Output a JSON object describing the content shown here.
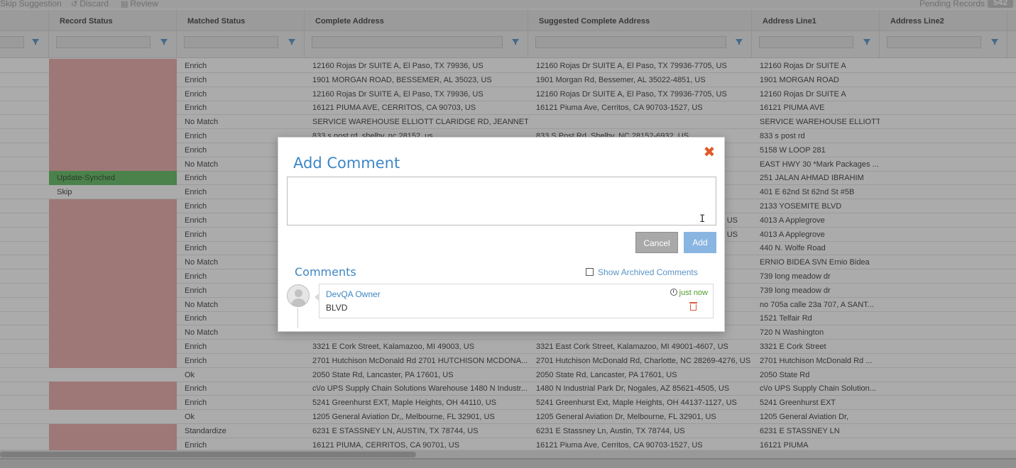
{
  "toolbar": {
    "skip_suggestion": "Skip Suggestion",
    "discard": "Discard",
    "review": "Review",
    "pending_records_label": "Pending Records",
    "pending_count": "542"
  },
  "grid": {
    "columns": [
      "Record Status",
      "Matched Status",
      "Complete Address",
      "Suggested Complete Address",
      "Address Line1",
      "Address Line2"
    ],
    "rows": [
      {
        "status": "",
        "status_color": "red",
        "matched": "Enrich",
        "complete": "12160 Rojas Dr SUITE A, El Paso, TX 79936, US",
        "suggested": "12160 Rojas Dr SUITE A, El Paso, TX 79936-7705, US",
        "line1": "12160 Rojas Dr SUITE A",
        "line2": ""
      },
      {
        "status": "",
        "status_color": "red",
        "matched": "Enrich",
        "complete": "1901 MORGAN ROAD, BESSEMER, AL 35023, US",
        "suggested": "1901 Morgan Rd, Bessemer, AL 35022-4851, US",
        "line1": "1901 MORGAN ROAD",
        "line2": ""
      },
      {
        "status": "",
        "status_color": "red",
        "matched": "Enrich",
        "complete": "12160 Rojas Dr SUITE A, El Paso, TX 79936, US",
        "suggested": "12160 Rojas Dr SUITE A, El Paso, TX 79936-7705, US",
        "line1": "12160 Rojas Dr SUITE A",
        "line2": ""
      },
      {
        "status": "",
        "status_color": "red",
        "matched": "Enrich",
        "complete": "16121 PIUMA AVE, CERRITOS, CA 90703, US",
        "suggested": "16121 Piuma Ave, Cerritos, CA 90703-1527, US",
        "line1": "16121 PIUMA AVE",
        "line2": ""
      },
      {
        "status": "",
        "status_color": "red",
        "matched": "No Match",
        "complete": "SERVICE WAREHOUSE ELLIOTT CLARIDGE RD, JEANNETTE, ...",
        "suggested": "",
        "line1": "SERVICE WAREHOUSE ELLIOTT ...",
        "line2": ""
      },
      {
        "status": "",
        "status_color": "red",
        "matched": "Enrich",
        "complete": "833 s post rd, shelby, nc 28152, us",
        "suggested": "833 S Post Rd, Shelby, NC 28152-6932, US",
        "line1": "833 s post rd",
        "line2": ""
      },
      {
        "status": "",
        "status_color": "red",
        "matched": "Enrich",
        "complete": "",
        "suggested": "",
        "line1": "5158 W LOOP 281",
        "line2": ""
      },
      {
        "status": "",
        "status_color": "red",
        "matched": "No Match",
        "complete": "",
        "suggested": "",
        "line1": "EAST HWY 30 *Mark Packages ...",
        "line2": ""
      },
      {
        "status": "Update-Synched",
        "status_color": "green",
        "matched": "Enrich",
        "complete": "",
        "suggested": "",
        "line1": "251 JALAN AHMAD IBRAHIM",
        "line2": ""
      },
      {
        "status": "Skip",
        "status_color": "none",
        "matched": "Enrich",
        "complete": "",
        "suggested": "",
        "line1": "401 E 62nd St 62nd St #5B",
        "line2": ""
      },
      {
        "status": "",
        "status_color": "red",
        "matched": "Enrich",
        "complete": "",
        "suggested": "",
        "line1": "2133 YOSEMITE BLVD",
        "line2": ""
      },
      {
        "status": "",
        "status_color": "red",
        "matched": "Enrich",
        "complete": "",
        "suggested": ", US",
        "line1": "4013 A Applegrove",
        "line2": ""
      },
      {
        "status": "",
        "status_color": "red",
        "matched": "Enrich",
        "complete": "",
        "suggested": ", US",
        "line1": "4013 A Applegrove",
        "line2": ""
      },
      {
        "status": "",
        "status_color": "red",
        "matched": "Enrich",
        "complete": "",
        "suggested": "",
        "line1": "440 N. Wolfe Road",
        "line2": ""
      },
      {
        "status": "",
        "status_color": "red",
        "matched": "No Match",
        "complete": "",
        "suggested": "",
        "line1": "ERNIO BIDEA S\\/N Ernio Bidea",
        "line2": ""
      },
      {
        "status": "",
        "status_color": "red",
        "matched": "Enrich",
        "complete": "",
        "suggested": "",
        "line1": "739 long meadow dr",
        "line2": ""
      },
      {
        "status": "",
        "status_color": "red",
        "matched": "Enrich",
        "complete": "",
        "suggested": "",
        "line1": "739 long meadow dr",
        "line2": ""
      },
      {
        "status": "",
        "status_color": "red",
        "matched": "No Match",
        "complete": "",
        "suggested": "",
        "line1": "no 705a calle 23a 707, A SANT...",
        "line2": ""
      },
      {
        "status": "",
        "status_color": "red",
        "matched": "Enrich",
        "complete": "",
        "suggested": "",
        "line1": "1521 Telfair Rd",
        "line2": ""
      },
      {
        "status": "",
        "status_color": "red",
        "matched": "No Match",
        "complete": "",
        "suggested": "",
        "line1": "720 N Washington",
        "line2": ""
      },
      {
        "status": "",
        "status_color": "red",
        "matched": "Enrich",
        "complete": "3321 E Cork Street, Kalamazoo, MI 49003, US",
        "suggested": "3321 East Cork Street, Kalamazoo, MI 49001-4607, US",
        "line1": "3321 E Cork Street",
        "line2": ""
      },
      {
        "status": "",
        "status_color": "red",
        "matched": "Enrich",
        "complete": "2701 Hutchison McDonald Rd 2701 HUTCHISON MCDONA...",
        "suggested": "2701 Hutchison McDonald Rd, Charlotte, NC 28269-4276, US",
        "line1": "2701 Hutchison McDonald Rd ...",
        "line2": ""
      },
      {
        "status": "",
        "status_color": "none",
        "matched": "Ok",
        "complete": "2050 State Rd, Lancaster, PA 17601, US",
        "suggested": "2050 State Rd, Lancaster, PA 17601, US",
        "line1": "2050 State Rd",
        "line2": ""
      },
      {
        "status": "",
        "status_color": "red",
        "matched": "Enrich",
        "complete": "c\\/o UPS Supply Chain Solutions Warehouse 1480 N Industr...",
        "suggested": "1480 N Industrial Park Dr, Nogales, AZ 85621-4505, US",
        "line1": "c\\/o UPS Supply Chain Solution...",
        "line2": ""
      },
      {
        "status": "",
        "status_color": "red",
        "matched": "Enrich",
        "complete": "5241 Greenhurst EXT, Maple Heights, OH 44110, US",
        "suggested": "5241 Greenhurst Ext, Maple Heights, OH 44137-1127, US",
        "line1": "5241 Greenhurst EXT",
        "line2": ""
      },
      {
        "status": "",
        "status_color": "none",
        "matched": "Ok",
        "complete": "1205 General Aviation Dr,, Melbourne, FL 32901, US",
        "suggested": "1205 General Aviation Dr, Melbourne, FL 32901, US",
        "line1": "1205 General Aviation Dr,",
        "line2": ""
      },
      {
        "status": "",
        "status_color": "red",
        "matched": "Standardize",
        "complete": "6231 E STASSNEY LN, AUSTIN, TX 78744, US",
        "suggested": "6231 E Stassney Ln, Austin, TX 78744, US",
        "line1": "6231 E STASSNEY LN",
        "line2": ""
      },
      {
        "status": "",
        "status_color": "red",
        "matched": "Enrich",
        "complete": "16121 PIUMA, CERRITOS, CA 90701, US",
        "suggested": "16121 Piuma Ave, Cerritos, CA 90703-1527, US",
        "line1": "16121 PIUMA",
        "line2": ""
      }
    ]
  },
  "modal": {
    "title": "Add Comment",
    "close_icon": "close-icon",
    "textarea_value": "",
    "cancel_label": "Cancel",
    "add_label": "Add",
    "comments_title": "Comments",
    "show_archived_label": "Show Archived Comments",
    "comments": [
      {
        "author": "DevQA Owner",
        "time": "just now",
        "text": "BLVD"
      }
    ]
  },
  "colors": {
    "accent": "#3d87c4",
    "status_red": "#e8a5a5",
    "status_green": "#5bb85b",
    "close": "#e05a26",
    "time_green": "#4f9d2e"
  }
}
